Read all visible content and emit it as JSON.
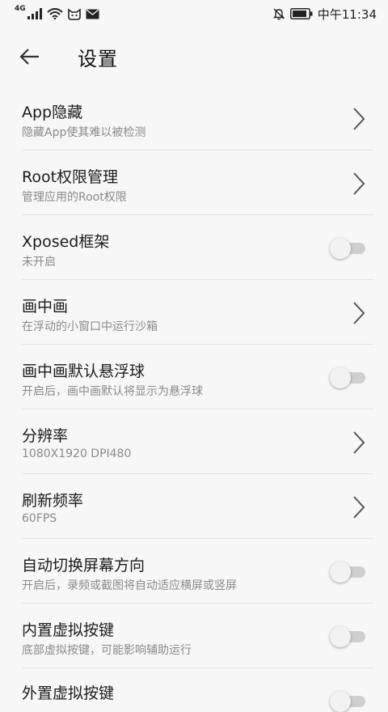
{
  "status_bar": {
    "network": "4G",
    "time": "中午11:34"
  },
  "header": {
    "title": "设置"
  },
  "settings": [
    {
      "title": "App隐藏",
      "subtitle": "隐藏App使其难以被检测",
      "control": "chevron"
    },
    {
      "title": "Root权限管理",
      "subtitle": "管理应用的Root权限",
      "control": "chevron"
    },
    {
      "title": "Xposed框架",
      "subtitle": "未开启",
      "control": "toggle",
      "enabled": false
    },
    {
      "title": "画中画",
      "subtitle": "在浮动的小窗口中运行沙箱",
      "control": "chevron"
    },
    {
      "title": "画中画默认悬浮球",
      "subtitle": "开启后，画中画默认将显示为悬浮球",
      "control": "toggle",
      "enabled": false
    },
    {
      "title": "分辨率",
      "subtitle": "1080X1920 DPI480",
      "control": "chevron"
    },
    {
      "title": "刷新频率",
      "subtitle": "60FPS",
      "control": "chevron"
    },
    {
      "title": "自动切换屏幕方向",
      "subtitle": "开启后，录频或截图将自动适应横屏或竖屏",
      "control": "toggle",
      "enabled": false
    },
    {
      "title": "内置虚拟按键",
      "subtitle": "底部虚拟按键，可能影响辅助运行",
      "control": "toggle",
      "enabled": false
    },
    {
      "title": "外置虚拟按键",
      "subtitle": "",
      "control": "toggle",
      "enabled": false
    }
  ]
}
